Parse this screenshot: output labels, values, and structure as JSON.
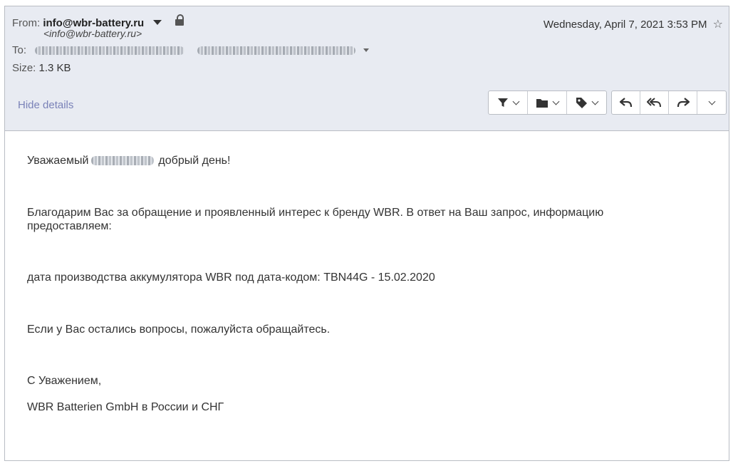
{
  "header": {
    "from_label": "From:",
    "sender": "info@wbr-battery.ru",
    "sender_address": "<info@wbr-battery.ru>",
    "to_label": "To:",
    "size_label": "Size:",
    "size_value": "1.3 KB",
    "date": "Wednesday, April 7, 2021 3:53 PM",
    "hide_details": "Hide details"
  },
  "toolbar": {
    "icons": [
      "filter-icon",
      "folder-icon",
      "tag-icon",
      "reply-icon",
      "reply-all-icon",
      "forward-icon",
      "more-chevron-icon"
    ]
  },
  "message": {
    "greeting_before": "Уважаемый",
    "greeting_after": "добрый день!",
    "thanks": "Благодарим Вас за обращение и проявленный интерес к бренду WBR. В ответ на Ваш запрос, информацию предоставляем:",
    "production_date": "дата производства аккумулятора WBR под дата-кодом: TBN44G - 15.02.2020",
    "questions": "Если у Вас остались вопросы, пожалуйста обращайтесь.",
    "regards": "С Уважением,",
    "company": "WBR Batterien GmbH в России и СНГ"
  },
  "colors": {
    "header_bg": "#e8ebf2",
    "link": "#7a82b8",
    "border": "#b9bdc4"
  }
}
